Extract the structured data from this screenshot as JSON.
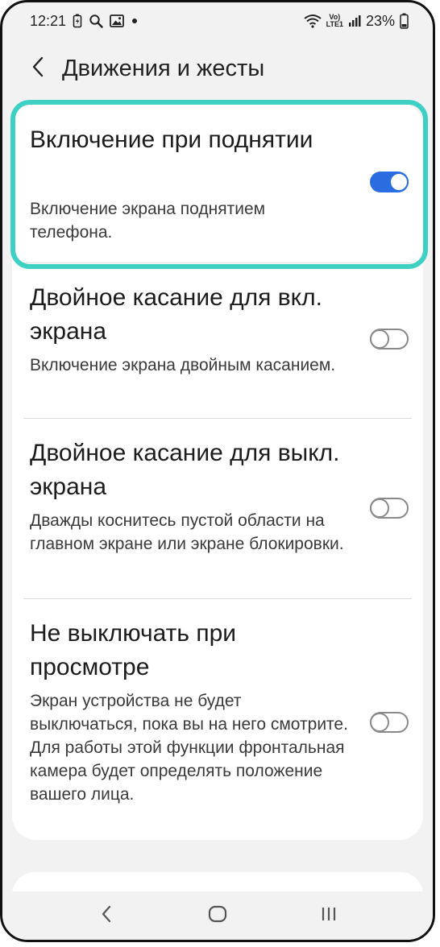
{
  "status_bar": {
    "time": "12:21",
    "network_label_top": "Vo)",
    "network_label_bottom": "LTE1",
    "battery_percent": "23%",
    "icons": [
      "charging-battery-icon",
      "search-icon",
      "gallery-icon",
      "notification-dot-icon",
      "wifi-icon",
      "signal-icon",
      "battery-icon"
    ]
  },
  "header": {
    "title": "Движения и жесты",
    "back_icon": "chevron-left-icon"
  },
  "settings": [
    {
      "title": "Включение при поднятии",
      "description": "Включение экрана поднятием телефона.",
      "enabled": true
    },
    {
      "title": "Двойное касание для вкл. экрана",
      "description": "Включение экрана двойным касанием.",
      "enabled": false
    },
    {
      "title": "Двойное касание для выкл. экрана",
      "description": "Дважды коснитесь пустой области на главном экране или экране блокировки.",
      "enabled": false
    },
    {
      "title": "Не выключать при просмотре",
      "description": "Экран устройства не будет выключаться, пока вы на него смотрите. Для работы этой функции фронтальная камера будет определять положение вашего лица.",
      "enabled": false
    }
  ],
  "highlight_color": "#3fd0c4",
  "toggle_on_color": "#2a6de0",
  "nav_bar": {
    "buttons": [
      "back-nav-icon",
      "home-nav-icon",
      "recents-nav-icon"
    ]
  }
}
